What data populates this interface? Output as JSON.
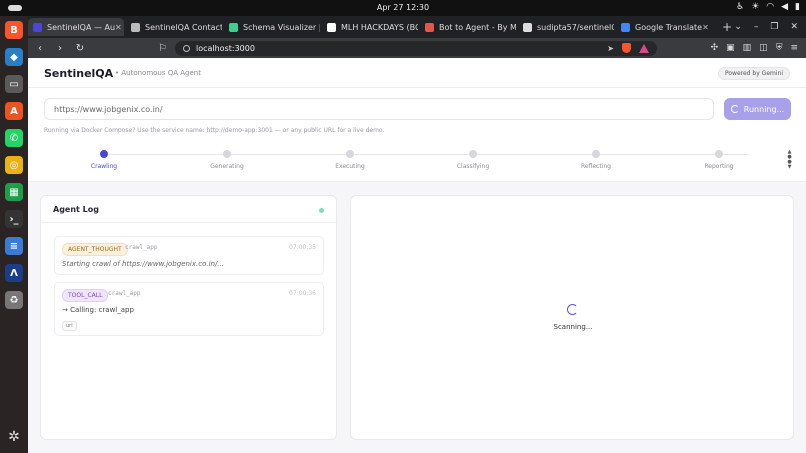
{
  "system": {
    "clock": "Apr 27  12:30"
  },
  "browser": {
    "tabs": [
      {
        "label": "SentinelQA — Au",
        "color": "#4b46d6",
        "active": true
      },
      {
        "label": "SentinelQA Contact",
        "color": "#bbbbbb",
        "active": false
      },
      {
        "label": "Schema Visualizer |",
        "color": "#3ecf8e",
        "active": false
      },
      {
        "label": "MLH HACKDAYS (BO",
        "color": "#ffffff",
        "active": false
      },
      {
        "label": "Bot to Agent - By M",
        "color": "#e2574c",
        "active": false
      },
      {
        "label": "sudipta57/sentinelQ",
        "color": "#dddddd",
        "active": false
      },
      {
        "label": "Google Translate",
        "color": "#4285f4",
        "active": false
      }
    ],
    "new_tab": "+",
    "url": "localhost:3000"
  },
  "app": {
    "brand": "SentinelQA",
    "tagline": "Autonomous QA Agent",
    "powered": "Powered by Gemini",
    "url_value": "https://www.jobgenix.co.in/",
    "run_label": "Running...",
    "hint": "Running via Docker Compose? Use the service name: http://demo-app:3001 — or any public URL for a live demo.",
    "steps": [
      {
        "label": "Crawling",
        "active": true
      },
      {
        "label": "Generating",
        "active": false
      },
      {
        "label": "Executing",
        "active": false
      },
      {
        "label": "Classifying",
        "active": false
      },
      {
        "label": "Reflecting",
        "active": false
      },
      {
        "label": "Reporting",
        "active": false
      }
    ],
    "log": {
      "title": "Agent Log",
      "entries": [
        {
          "badge": "AGENT_THOUGHT",
          "fn": "crawl_app",
          "time": "07:00:35",
          "message": "Starting crawl of https://www.jobgenix.co.in/..."
        },
        {
          "badge": "TOOL_CALL",
          "fn": "crawl_app",
          "time": "07:00:36",
          "message": "→ Calling: crawl_app",
          "chip": "url"
        }
      ]
    },
    "status": "Scanning..."
  }
}
